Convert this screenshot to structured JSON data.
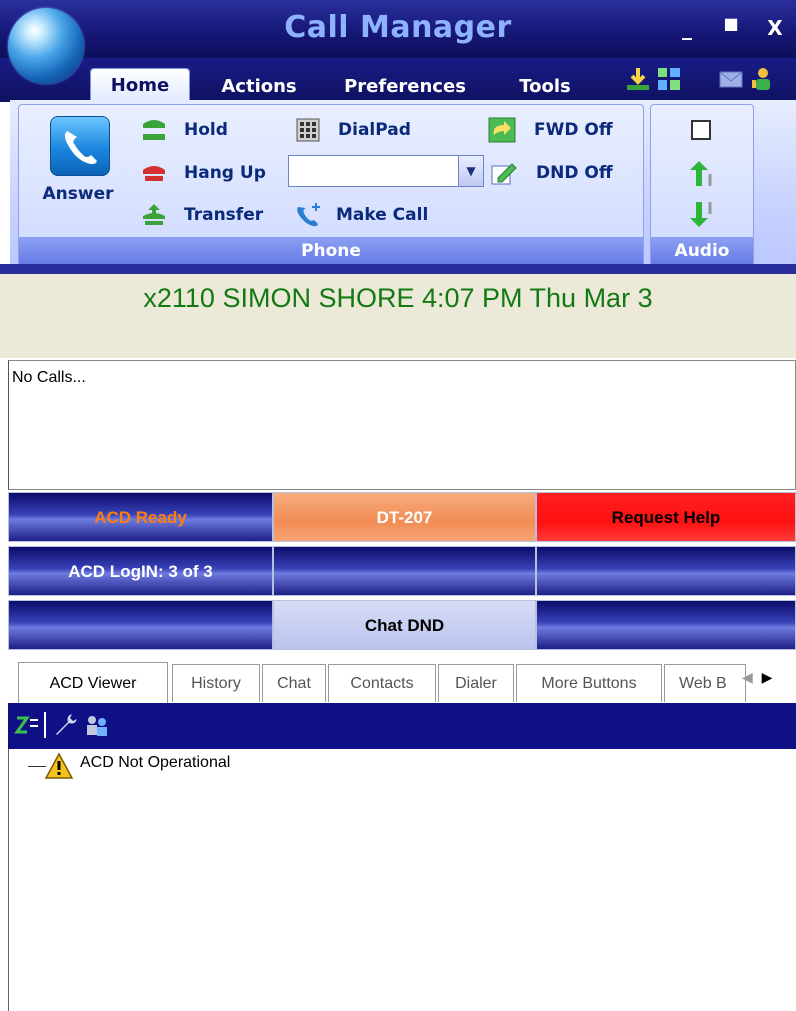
{
  "window": {
    "title": "Call Manager",
    "controls": [
      "_",
      "■",
      "X"
    ]
  },
  "ribbon_tabs": [
    {
      "label": "Home",
      "active": true
    },
    {
      "label": "Actions"
    },
    {
      "label": "Preferences"
    },
    {
      "label": "Tools"
    }
  ],
  "toolbar_icons": [
    "download-icon",
    "layout-icon",
    "mail-icon",
    "user-status-icon"
  ],
  "phone_group": {
    "label": "Phone",
    "answer": "Answer",
    "hold": "Hold",
    "hang_up": "Hang Up",
    "transfer": "Transfer",
    "dialpad": "DialPad",
    "make_call": "Make Call",
    "fwd": "FWD Off",
    "dnd": "DND Off",
    "dial_value": ""
  },
  "audio_group": {
    "label": "Audio"
  },
  "status_line": "x2110 SIMON SHORE  4:07 PM Thu Mar 3",
  "calls_text": "No Calls...",
  "acd_buttons": [
    {
      "label": "ACD Ready",
      "style": "navy",
      "color": "#ff7f0e"
    },
    {
      "label": "DT-207",
      "style": "orange"
    },
    {
      "label": "Request Help",
      "style": "red"
    },
    {
      "label": "ACD LogIN: 3 of 3",
      "style": "navy"
    },
    {
      "label": "",
      "style": "navy"
    },
    {
      "label": "",
      "style": "navy"
    },
    {
      "label": "",
      "style": "navy"
    },
    {
      "label": "Chat DND",
      "style": "lavender"
    },
    {
      "label": "",
      "style": "navy"
    }
  ],
  "bottom_tabs": [
    "ACD Viewer",
    "History",
    "Chat",
    "Contacts",
    "Dialer",
    "More Buttons",
    "Web B"
  ],
  "tree": {
    "item": "ACD Not Operational"
  },
  "colors": {
    "title_text": "#8fb2ff",
    "status_text": "#137a13",
    "acd_ready_text": "#ff7f0e"
  }
}
